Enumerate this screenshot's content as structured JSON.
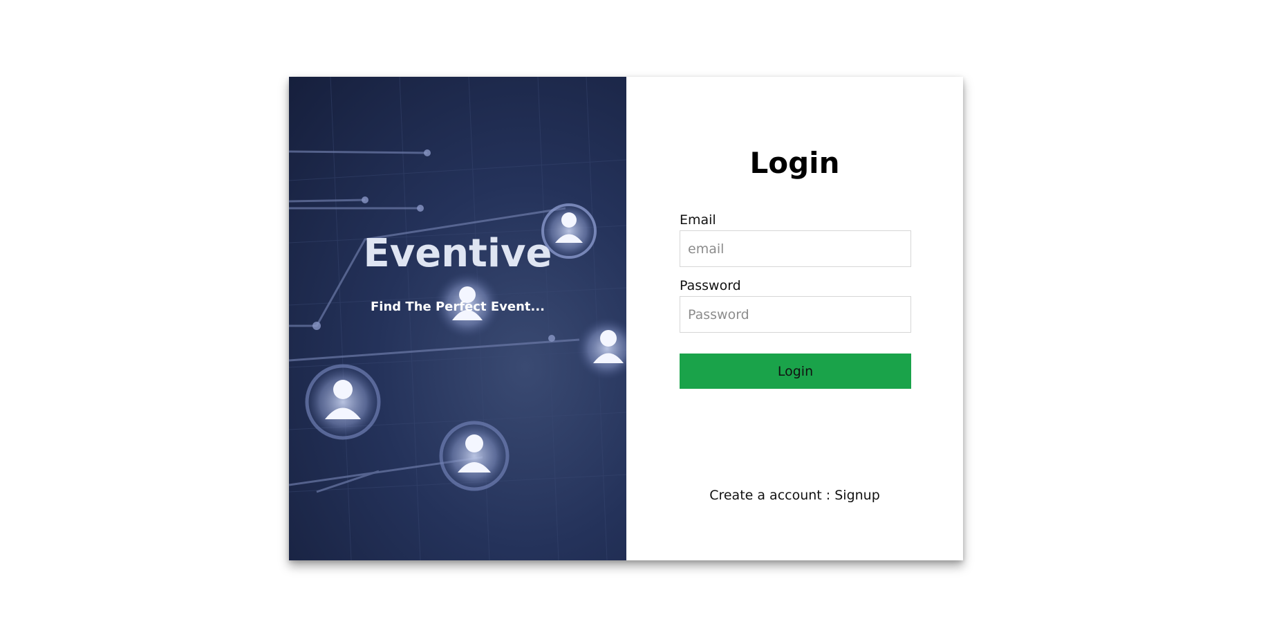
{
  "brand": {
    "name": "Eventive",
    "tagline": "Find The Perfect Event..."
  },
  "login": {
    "title": "Login",
    "email_label": "Email",
    "email_placeholder": "email",
    "password_label": "Password",
    "password_placeholder": "Password",
    "submit_label": "Login",
    "signup_prompt": "Create a account : ",
    "signup_link": "Signup"
  },
  "colors": {
    "accent": "#1aa34a",
    "hero_bg": "#1c2748"
  }
}
